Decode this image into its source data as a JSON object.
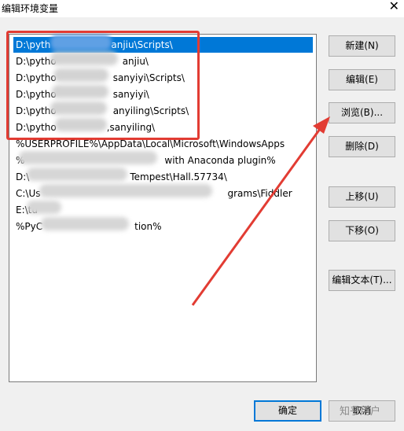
{
  "window": {
    "title": "编辑环境变量",
    "close_glyph": "✕"
  },
  "list": {
    "items": [
      {
        "text": "D:\\pyth",
        "tail": "anjiu\\Scripts\\",
        "selected": true
      },
      {
        "text": "D:\\pytho",
        "tail": "anjiu\\"
      },
      {
        "text": "D:\\pytho",
        "tail": "sanyiyi\\Scripts\\"
      },
      {
        "text": "D:\\pytho",
        "tail": "sanyiyi\\"
      },
      {
        "text": "D:\\pytho",
        "tail": "anyiling\\Scripts\\"
      },
      {
        "text": "D:\\pytho",
        "tail": ",sanyiling\\"
      },
      {
        "text": "%USERPROFILE%\\AppData\\Local\\Microsoft\\WindowsApps",
        "tail": ""
      },
      {
        "text": "%",
        "tail": "with Anaconda plugin%"
      },
      {
        "text": "D:\\",
        "tail": "Tempest\\Hall.57734\\"
      },
      {
        "text": "C:\\Us",
        "tail": "grams\\Fiddler"
      },
      {
        "text": "E:\\tu",
        "tail": ""
      },
      {
        "text": "%PyC",
        "tail": "tion%"
      }
    ]
  },
  "buttons": {
    "new": "新建(N)",
    "edit": "编辑(E)",
    "browse": "浏览(B)...",
    "delete": "删除(D)",
    "move_up": "上移(U)",
    "move_down": "下移(O)",
    "edit_text": "编辑文本(T)...",
    "ok": "确定",
    "cancel": "取消"
  },
  "watermark": "知乎用户",
  "colors": {
    "selection": "#0078d7",
    "annotation": "#e23c33"
  }
}
